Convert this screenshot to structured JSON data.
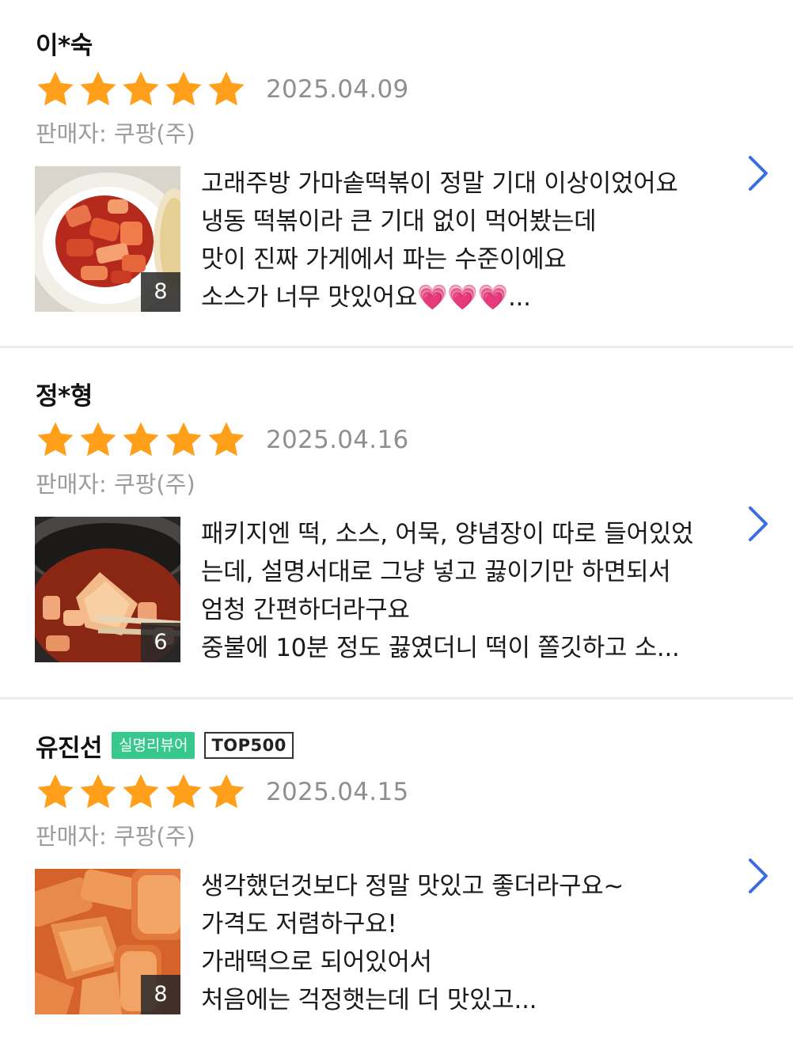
{
  "reviews": [
    {
      "name": "이*숙",
      "badges": [],
      "rating": 5,
      "date": "2025.04.09",
      "seller": "판매자: 쿠팡(주)",
      "photo_count": "8",
      "lines": [
        "고래주방 가마솥떡볶이 정말 기대 이상이었어요",
        "냉동 떡볶이라 큰 기대 없이 먹어봤는데",
        "맛이 진짜 가게에서 파는 수준이에요",
        "소스가 너무 맛있어요💗💗💗..."
      ]
    },
    {
      "name": "정*형",
      "badges": [],
      "rating": 5,
      "date": "2025.04.16",
      "seller": "판매자: 쿠팡(주)",
      "photo_count": "6",
      "lines": [
        "패키지엔 떡, 소스, 어묵, 양념장이 따로 들어있었",
        "는데, 설명서대로 그냥 넣고 끓이기만 하면되서",
        "엄청 간편하더라구요",
        "중불에 10분 정도 끓였더니 떡이 쫄깃하고 소..."
      ]
    },
    {
      "name": "유진선",
      "badges": [
        "실명리뷰어",
        "TOP500"
      ],
      "rating": 5,
      "date": "2025.04.15",
      "seller": "판매자: 쿠팡(주)",
      "photo_count": "8",
      "lines": [
        "생각했던것보다 정말 맛있고 좋더라구요~",
        "가격도 저렴하구요!",
        "가래떡으로 되어있어서",
        "처음에는 걱정햇는데 더 맛있고..."
      ]
    }
  ],
  "icons": {
    "star": "star-icon",
    "chevron": "chevron-right-icon"
  },
  "colors": {
    "star": "#ff9f1a",
    "date": "#8f8f8f",
    "seller": "#9c9c9c",
    "chevron": "#3b6fe0",
    "badge_green": "#36c88c"
  }
}
